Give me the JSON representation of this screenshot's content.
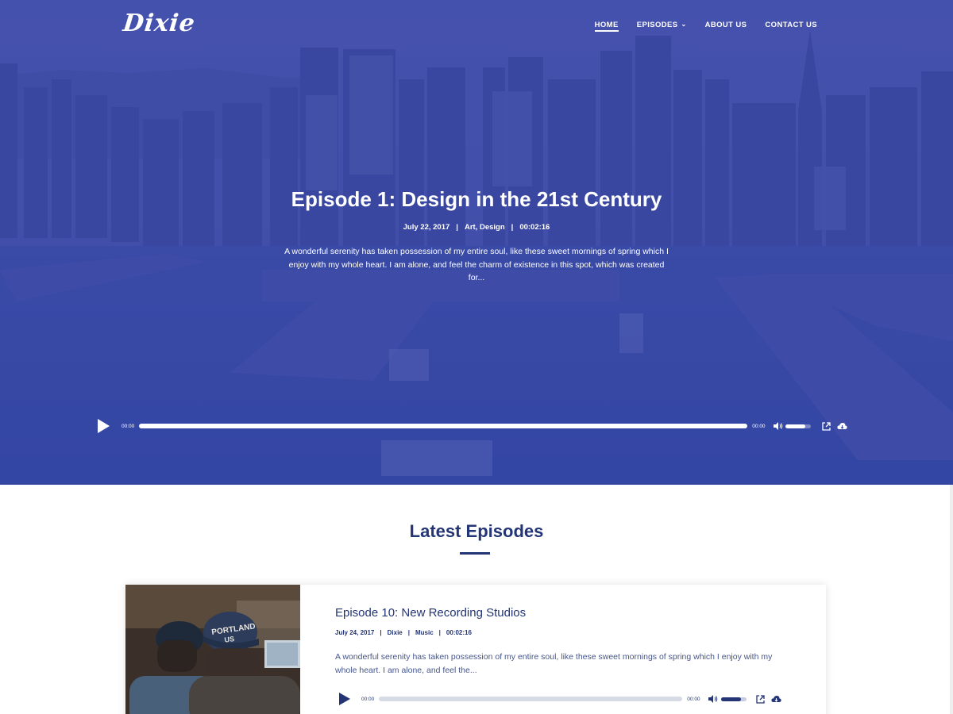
{
  "site": {
    "logo": "Dixie"
  },
  "nav": {
    "items": [
      {
        "label": "HOME",
        "active": true
      },
      {
        "label": "EPISODES",
        "has_dropdown": true
      },
      {
        "label": "ABOUT US"
      },
      {
        "label": "CONTACT US"
      }
    ]
  },
  "hero": {
    "title": "Episode 1: Design in the 21st Century",
    "date": "July 22, 2017",
    "categories": "Art, Design",
    "duration": "00:02:16",
    "separator": "|",
    "description": "A wonderful serenity has taken possession of my entire soul, like these sweet mornings of spring which I enjoy with my whole heart. I am alone, and feel the charm of existence in this spot, which was created for...",
    "player": {
      "current_time": "00:00",
      "total_time": "00:00",
      "progress": 0,
      "volume": 0.8
    }
  },
  "latest": {
    "title": "Latest Episodes",
    "episodes": [
      {
        "title": "Episode 10: New Recording Studios",
        "date": "July 24, 2017",
        "author": "Dixie",
        "category": "Music",
        "duration": "00:02:16",
        "separator": "|",
        "description": "A wonderful serenity has taken possession of my entire soul, like these sweet mornings of spring which I enjoy with my whole heart. I am alone, and feel the...",
        "image_caption": "PORTLAND US",
        "player": {
          "current_time": "00:00",
          "total_time": "00:00",
          "progress": 0,
          "volume": 0.8
        }
      }
    ]
  },
  "icons": {
    "play": "play-icon",
    "volume": "volume-icon",
    "external": "external-link-icon",
    "download": "cloud-download-icon",
    "chevron": "chevron-down-icon"
  },
  "colors": {
    "brand_dark": "#233574",
    "hero_overlay": "#3446a8",
    "white": "#ffffff"
  }
}
